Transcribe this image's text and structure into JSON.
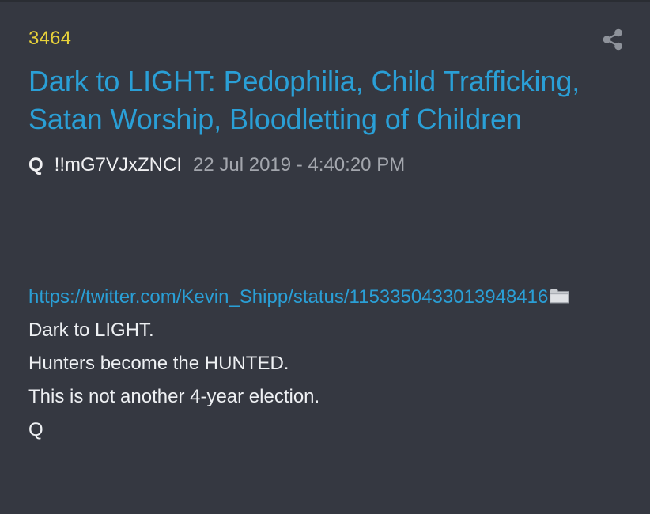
{
  "post": {
    "number": "3464",
    "title": "Dark to LIGHT: Pedophilia, Child Trafficking, Satan Worship, Bloodletting of Children",
    "author": "Q",
    "tripcode": "!!mG7VJxZNCI",
    "timestamp": "22 Jul 2019 - 4:40:20 PM",
    "link": "https://twitter.com/Kevin_Shipp/status/1153350433013948416",
    "lines": [
      "Dark to LIGHT.",
      "Hunters become the HUNTED.",
      "This is not another 4-year election.",
      "Q"
    ]
  },
  "icons": {
    "share": "share-icon",
    "archive": "folder-icon"
  },
  "colors": {
    "background": "#353841",
    "post_number": "#e8d23a",
    "title": "#2a9fd6",
    "link": "#2a9fd6",
    "text": "#eef0f3",
    "timestamp": "#a3a6ad"
  }
}
